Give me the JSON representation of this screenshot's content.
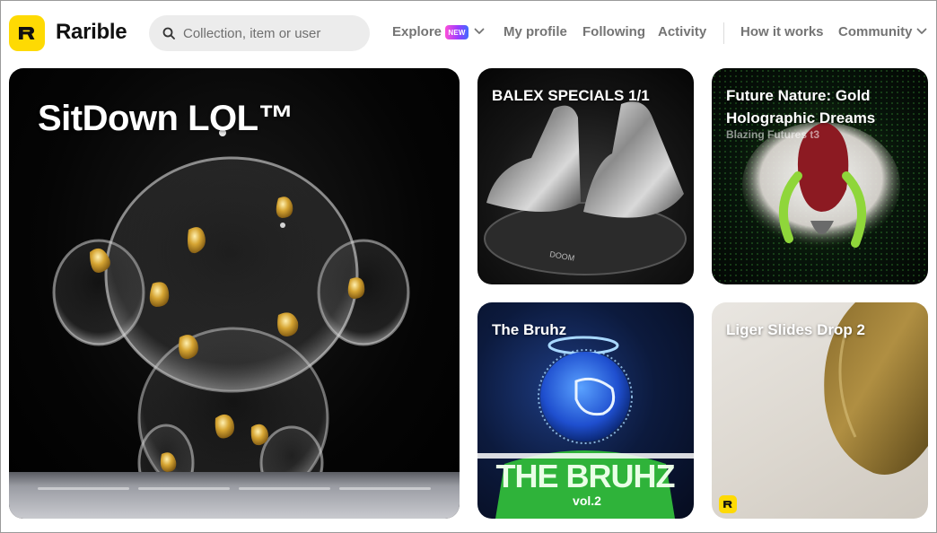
{
  "brand": {
    "name": "Rarible",
    "logo_color": "#feda03"
  },
  "search": {
    "placeholder": "Collection, item or user"
  },
  "nav": {
    "explore": "Explore",
    "new_badge": "NEW",
    "my_profile": "My profile",
    "following": "Following",
    "activity": "Activity",
    "how_it_works": "How it works",
    "community": "Community"
  },
  "cards": {
    "hero": {
      "title": "SitDown LOL™"
    },
    "balex": {
      "title": "BALEX SPECIALS 1/1"
    },
    "future_nature": {
      "title": "Future Nature: Gold Holographic Dreams",
      "subtitle": "Blazing Futures t3"
    },
    "bruhz": {
      "title": "The Bruhz",
      "art_text": "THE BRUHZ",
      "art_sub": "vol.2"
    },
    "liger": {
      "title": "Liger Slides Drop 2"
    }
  },
  "colors": {
    "accent": "#feda03",
    "nav_text": "#747474",
    "badge_gradient": [
      "#ff4fd8",
      "#9b3cff",
      "#3f6bff"
    ]
  }
}
